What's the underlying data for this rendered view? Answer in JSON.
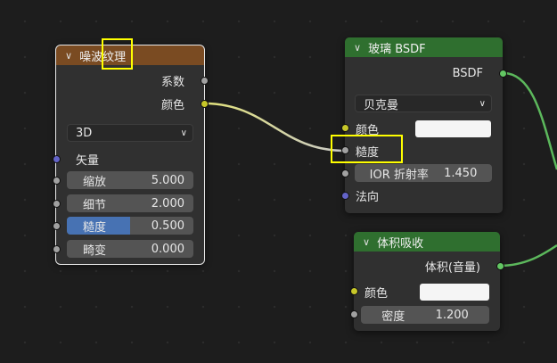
{
  "noise_node": {
    "title": "噪波纹理",
    "outputs": [
      "系数",
      "颜色"
    ],
    "dimension": "3D",
    "vector_label": "矢量",
    "fields": [
      {
        "label": "缩放",
        "value": "5.000"
      },
      {
        "label": "细节",
        "value": "2.000"
      },
      {
        "label": "糙度",
        "value": "0.500",
        "fill_fraction": 0.5
      },
      {
        "label": "畸变",
        "value": "0.000"
      }
    ],
    "header_color": "#7a4b22"
  },
  "glass_node": {
    "title": "玻璃 BSDF",
    "output": "BSDF",
    "distribution": "贝克曼",
    "color_label": "颜色",
    "roughness_label": "糙度",
    "ior_label": "IOR 折射率",
    "ior_value": "1.450",
    "normal_label": "法向",
    "header_color": "#2f6f2f"
  },
  "volume_node": {
    "title": "体积吸收",
    "output": "体积(音量)",
    "color_label": "颜色",
    "density_label": "密度",
    "density_value": "1.200",
    "header_color": "#2f6f2f"
  },
  "highlight_color": "#ffff00"
}
